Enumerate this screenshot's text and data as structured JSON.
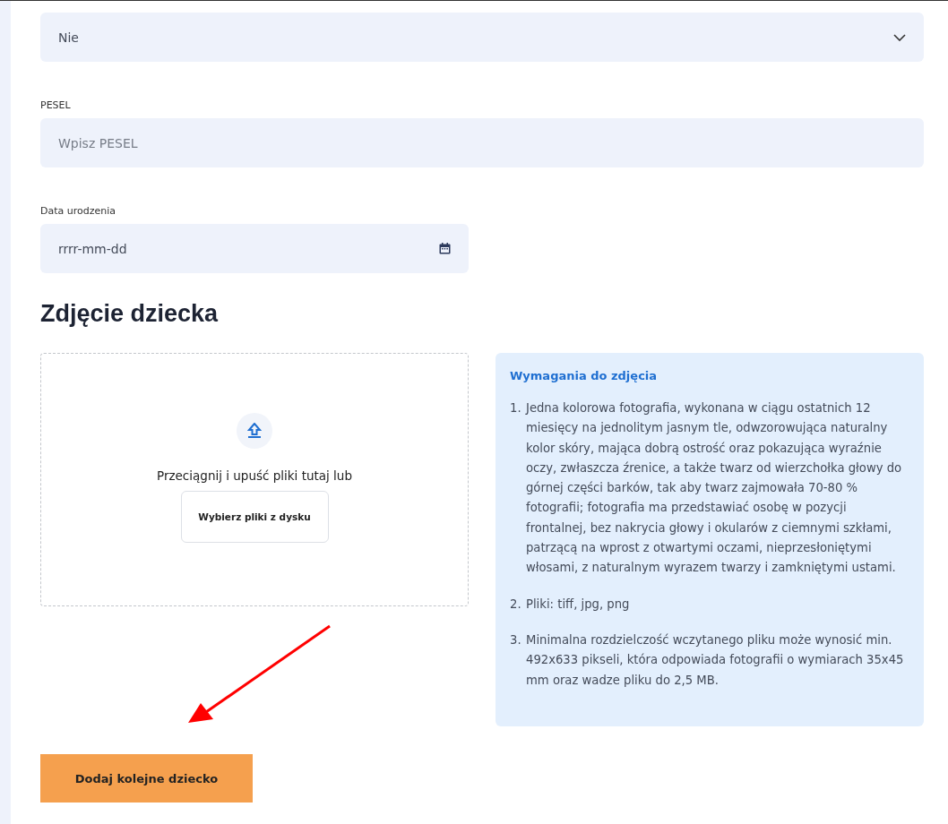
{
  "marital_select": {
    "value": "Nie"
  },
  "pesel": {
    "label": "PESEL",
    "placeholder": "Wpisz PESEL"
  },
  "birth_date": {
    "label": "Data urodzenia",
    "placeholder": "rrrr-mm-dd"
  },
  "photo_section": {
    "heading": "Zdjęcie dziecka",
    "upload": {
      "prompt": "Przeciągnij i upuść pliki tutaj lub",
      "button": "Wybierz pliki z dysku"
    },
    "requirements": {
      "title": "Wymagania do zdjęcia",
      "items": [
        {
          "number": "1.",
          "text": "Jedna kolorowa fotografia, wykonana w ciągu ostatnich 12 miesięcy na jednolitym jasnym tle, odwzorowująca naturalny kolor skóry, mająca dobrą ostrość oraz pokazująca wyraźnie oczy, zwłaszcza źrenice, a także twarz od wierzchołka głowy do górnej części barków, tak aby twarz zajmowała 70-80 % fotografii; fotografia ma przedstawiać osobę w pozycji frontalnej, bez nakrycia głowy i okularów z ciemnymi szkłami, patrzącą na wprost z otwartymi oczami, nieprzesłoniętymi włosami, z naturalnym wyrazem twarzy i zamkniętymi ustami."
        },
        {
          "number": "2.",
          "text": "Pliki: tiff, jpg, png"
        },
        {
          "number": "3.",
          "text": "Minimalna rozdzielczość wczytanego pliku może wynosić min. 492x633 pikseli, która odpowiada fotografii o wymiarach 35x45 mm oraz wadze pliku do 2,5 MB."
        }
      ]
    }
  },
  "add_button": "Dodaj kolejne dziecko"
}
